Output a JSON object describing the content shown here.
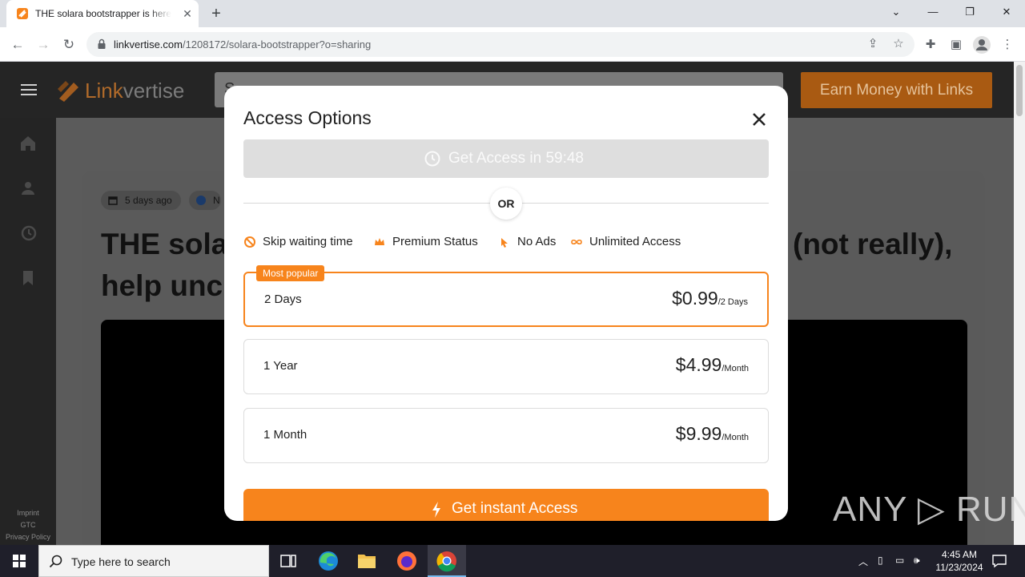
{
  "browser": {
    "tab_title": "THE solara bootstrapper is here, ",
    "tab_close": "✕",
    "new_tab": "+",
    "url_domain": "linkvertise.com",
    "url_path": "/1208172/solara-bootstrapper?o=sharing",
    "window_controls": {
      "minimize": "—",
      "restore": "❐",
      "close": "✕",
      "tab_search": "⌄"
    }
  },
  "site": {
    "logo_part1": "Link",
    "logo_part2": "vertise",
    "search_placeholder": "S",
    "earn_button": "Earn Money with Links",
    "footer_links": [
      "Imprint",
      "GTC",
      "Privacy Policy"
    ]
  },
  "article": {
    "date_chip": "5 days ago",
    "second_chip": "N",
    "title_line1_left": "THE sola",
    "title_line1_right": "(not really),",
    "title_line2": "help unc"
  },
  "modal": {
    "title": "Access Options",
    "timer_label": "Get Access in 59:48",
    "or_label": "OR",
    "features": [
      "Skip waiting time",
      "Premium Status",
      "No Ads",
      "Unlimited Access"
    ],
    "popular_badge": "Most popular",
    "plans": [
      {
        "name": "2 Days",
        "price": "$0.99",
        "period": "/2 Days",
        "selected": true
      },
      {
        "name": "1 Year",
        "price": "$4.99",
        "period": "/Month",
        "selected": false
      },
      {
        "name": "1 Month",
        "price": "$9.99",
        "period": "/Month",
        "selected": false
      }
    ],
    "cta_label": "Get instant Access",
    "accent_color": "#f7841c"
  },
  "watermark": "ANY ▷ RUN",
  "taskbar": {
    "search_placeholder": "Type here to search",
    "time": "4:45 AM",
    "date": "11/23/2024"
  }
}
